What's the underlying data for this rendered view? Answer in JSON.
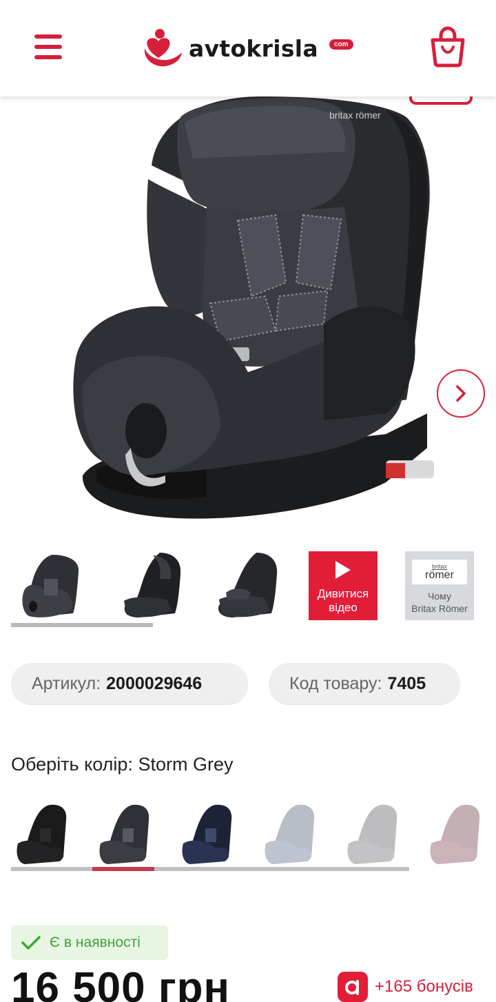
{
  "header": {
    "logo_text": "avtokrisla",
    "logo_badge": "com",
    "menu_icon": "hamburger-menu-icon",
    "cart_icon": "shopping-bag-icon"
  },
  "gallery": {
    "main_image_alt": "Britax Römer car seat Storm Grey",
    "seat_brand_label": "britax römer",
    "next_icon": "chevron-right-icon",
    "video_thumb_label": "Дивитися відео",
    "why_brand_top": "britax",
    "why_brand_bottom": "römer",
    "why_label_line1": "Чому",
    "why_label_line2": "Britax Römer"
  },
  "sku": {
    "article_label": "Артикул:",
    "article_value": "2000029646",
    "code_label": "Код товару:",
    "code_value": "7405"
  },
  "color_picker": {
    "title": "Оберіть колір: Storm Grey",
    "selected_index": 1
  },
  "availability": {
    "label": "Є в наявності",
    "icon": "check-icon"
  },
  "price": {
    "value": "16 500 грн"
  },
  "bonus": {
    "icon_letter": "a",
    "text": "+165 бонусів"
  },
  "colors": {
    "accent": "#d71f3a",
    "success": "#3fa33a",
    "seat_dark": "#2f3034"
  }
}
